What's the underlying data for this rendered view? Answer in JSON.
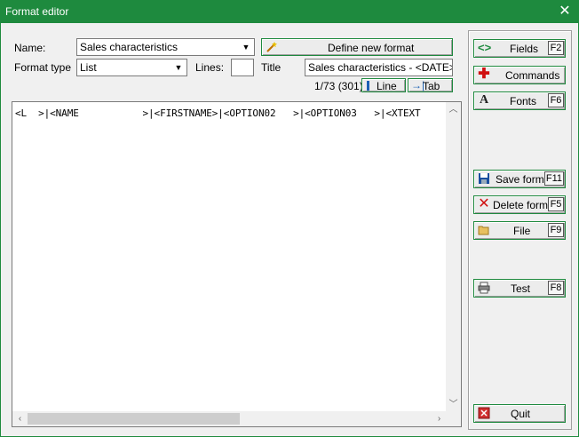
{
  "window": {
    "title": "Format editor",
    "close_glyph": "✕"
  },
  "form": {
    "name_label": "Name:",
    "name_value": "Sales characteristics",
    "format_type_label": "Format type",
    "format_type_value": "List",
    "lines_label": "Lines:",
    "lines_value": "",
    "title_label": "Title",
    "title_value": "Sales characteristics - <DATE>",
    "define_button": "Define new format",
    "position_text": "1/73 (301)",
    "line_button": "Line",
    "tab_button": "Tab"
  },
  "editor": {
    "content": "<L  >|<NAME           >|<FIRSTNAME>|<OPTION02   >|<OPTION03   >|<XTEXT"
  },
  "side_buttons": {
    "fields": {
      "label": "Fields",
      "key": "F2"
    },
    "commands": {
      "label": "Commands"
    },
    "fonts": {
      "label": "Fonts",
      "key": "F6"
    },
    "save": {
      "label": "Save format",
      "key": "F11"
    },
    "delete": {
      "label": "Delete format",
      "key": "F5"
    },
    "file": {
      "label": "File",
      "key": "F9"
    },
    "test": {
      "label": "Test",
      "key": "F8"
    },
    "quit": {
      "label": "Quit"
    }
  },
  "colors": {
    "accent": "#1e8a3e"
  },
  "icons": {
    "fields": "code-brackets-icon",
    "commands": "red-plus-icon",
    "fonts": "font-a-icon",
    "save": "floppy-disk-icon",
    "delete": "red-x-icon",
    "file": "folder-icon",
    "test": "printer-icon",
    "quit": "exit-door-icon",
    "define": "magic-wand-icon"
  }
}
